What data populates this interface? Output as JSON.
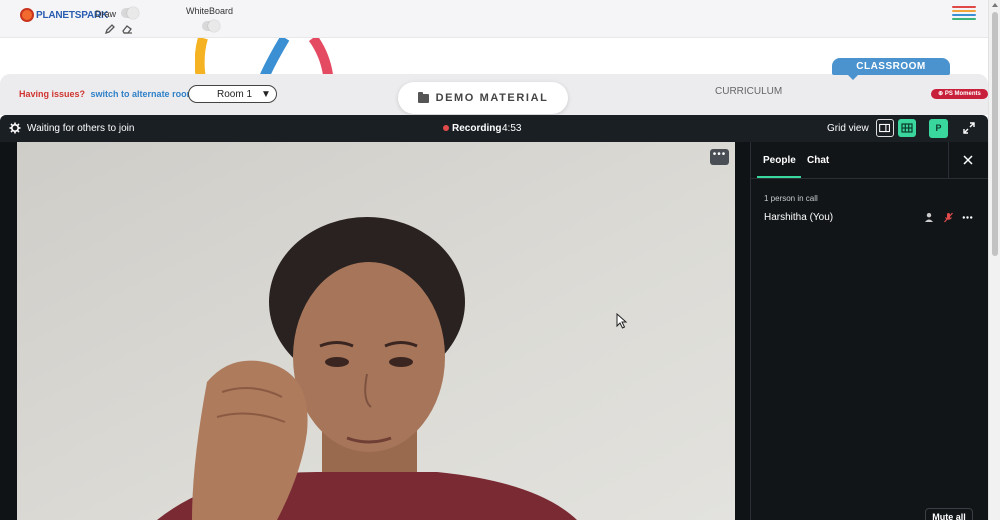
{
  "toolbar": {
    "logo_text": "PLANETSPARK",
    "draw_label": "Draw",
    "whiteboard_label": "WhiteBoard",
    "icons": [
      "pencil-icon",
      "eraser-icon",
      "hamburger-menu-icon"
    ]
  },
  "classroom": {
    "having_issues": "Having issues?",
    "switch_link": "switch to alternate room",
    "room_selected": "Room 1",
    "room_arrow": "▼",
    "demo_material": "DEMO MATERIAL",
    "curriculum": "CURRICULUM",
    "classroom_tab": "CLASSROOM",
    "moments_badge": "PS Moments"
  },
  "callbar": {
    "status": "Waiting for others to join",
    "recording_label": "Recording",
    "recording_time": "4:53",
    "view_label": "Grid view",
    "avatar_letter": "P"
  },
  "video": {
    "more_label": "•••"
  },
  "panel": {
    "tabs": [
      "People",
      "Chat"
    ],
    "active_tab": "People",
    "count_text": "1 person in call",
    "participants": [
      {
        "name": "Harshitha (You)"
      }
    ],
    "mute_all": "Mute all"
  },
  "colors": {
    "accent_green": "#39d79e",
    "recording_red": "#e24b4b",
    "classroom_blue": "#4a93cf",
    "issues_red": "#d0352f",
    "link_blue": "#2f80c8",
    "call_bg": "#1a1f24",
    "ps_moments_red": "#c8203b"
  }
}
